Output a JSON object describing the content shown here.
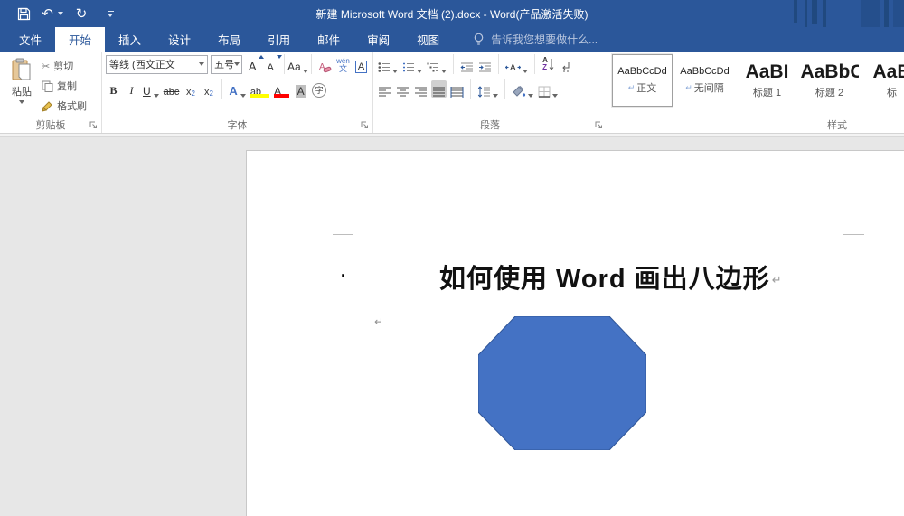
{
  "titlebar": {
    "title": "新建 Microsoft Word 文档 (2).docx - Word(产品激活失败)",
    "icons": {
      "undo_glyph": "↶",
      "redo_glyph": "↻"
    }
  },
  "tabrow": {
    "tabs": [
      "文件",
      "开始",
      "插入",
      "设计",
      "布局",
      "引用",
      "邮件",
      "审阅",
      "视图"
    ],
    "active_tab": "开始",
    "tell_me": "告诉我您想要做什么..."
  },
  "ribbon": {
    "clipboard": {
      "label": "剪贴板",
      "paste": "粘贴",
      "cut": "剪切",
      "copy": "复制",
      "format_painter": "格式刷",
      "scissors_glyph": "✂"
    },
    "font": {
      "label": "字体",
      "font_name": "等线 (西文正文",
      "font_size": "五号",
      "grow": "A",
      "shrink": "A",
      "change_case": "Aa",
      "phonetic_top": "wén",
      "phonetic_bottom": "文",
      "char_border": "A",
      "bold": "B",
      "italic": "I",
      "underline": "U",
      "strike": "abc",
      "sub_base": "x",
      "sub_script": "2",
      "sup_base": "x",
      "sup_script": "2",
      "text_effects": "A",
      "highlight": "ab",
      "font_color": "A",
      "char_shading": "A",
      "enclose": "字"
    },
    "paragraph": {
      "label": "段落",
      "asian_layout": "A",
      "sort_a": "A",
      "sort_z": "Z"
    },
    "styles": {
      "label": "样式",
      "items": [
        {
          "prefix": "↵",
          "sample": "AaBbCcDd",
          "name": "正文"
        },
        {
          "prefix": "↵",
          "sample": "AaBbCcDd",
          "name": "无间隔"
        },
        {
          "sample": "AaBI",
          "name": "标题 1"
        },
        {
          "sample": "AaBbC",
          "name": "标题 2"
        },
        {
          "sample": "AaB",
          "name": "标"
        }
      ]
    }
  },
  "document": {
    "bullet": "·",
    "heading": "如何使用 Word 画出八边形",
    "pilcrow": "↵",
    "octagon_fill": "#4472c4",
    "octagon_stroke": "#2f5597"
  },
  "colors": {
    "titlebar_blue": "#2b579a",
    "accent_blue": "#4472c4",
    "highlight_yellow": "#ffff00",
    "font_color_red": "#ff0000"
  }
}
